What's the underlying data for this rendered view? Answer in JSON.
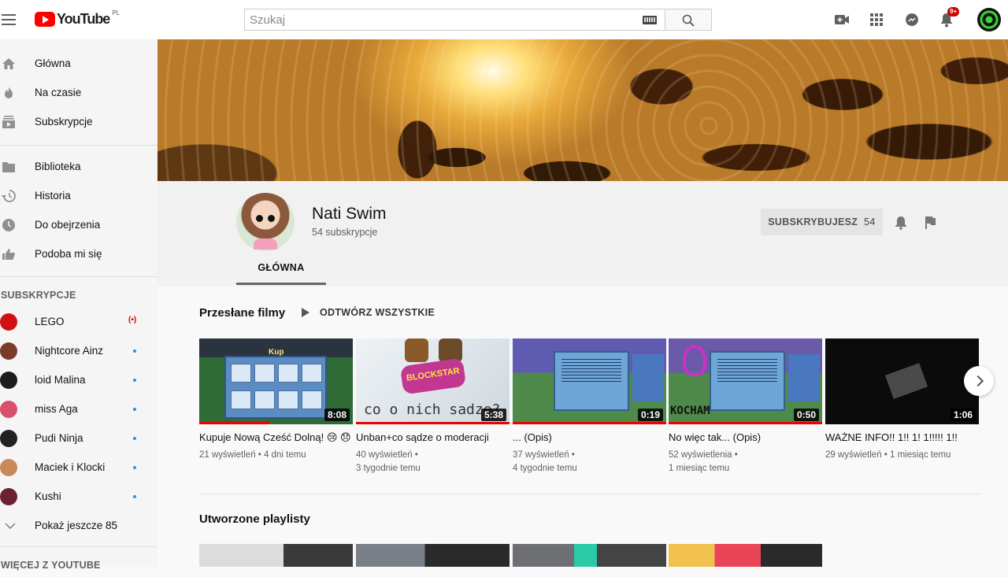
{
  "header": {
    "logo_text": "YouTube",
    "logo_country": "PL",
    "search_placeholder": "Szukaj",
    "notifications_badge": "9+"
  },
  "sidebar": {
    "main_items": [
      {
        "label": "Główna",
        "icon": "home-icon"
      },
      {
        "label": "Na czasie",
        "icon": "flame-icon"
      },
      {
        "label": "Subskrypcje",
        "icon": "subscriptions-icon"
      }
    ],
    "library_items": [
      {
        "label": "Biblioteka",
        "icon": "folder-icon"
      },
      {
        "label": "Historia",
        "icon": "history-icon"
      },
      {
        "label": "Do obejrzenia",
        "icon": "clock-icon"
      },
      {
        "label": "Podoba mi się",
        "icon": "thumb-up-icon"
      }
    ],
    "subscriptions_heading": "SUBSKRYPCJE",
    "subscriptions": [
      {
        "label": "LEGO",
        "live": "(•)",
        "color": "#d01012"
      },
      {
        "label": "Nightcore Ainz",
        "color": "#7a3c2a"
      },
      {
        "label": "loid Malina",
        "color": "#1c1c1c"
      },
      {
        "label": "miss Aga",
        "color": "#d9506a"
      },
      {
        "label": "Pudi Ninja",
        "color": "#222222"
      },
      {
        "label": "Maciek i Klocki",
        "color": "#c98a5a"
      },
      {
        "label": "Kushi",
        "color": "#6a2230"
      }
    ],
    "show_more": "Pokaż jeszcze 85",
    "more_heading": "WIĘCEJ Z YOUTUBE"
  },
  "channel": {
    "name": "Nati Swim",
    "subscribers": "54 subskrypcje",
    "subscribe_label": "SUBSKRYBUJESZ",
    "subscribe_count": "54",
    "tab_home": "GŁÓWNA"
  },
  "uploads": {
    "title": "Przesłane filmy",
    "play_all": "ODTWÓRZ WSZYSTKIE",
    "videos": [
      {
        "title": "Kupuje Nową Cześć Dolną! 😢 😞",
        "duration": "8:08",
        "meta1": "21 wyświetleń • 4 dni temu",
        "meta2": "",
        "progress": 0.46
      },
      {
        "title": "Unban+co sądze o moderacji",
        "duration": "5:38",
        "meta1": "40 wyświetleń •",
        "meta2": "3 tygodnie temu",
        "progress": 1.0
      },
      {
        "title": "... (Opis)",
        "duration": "0:19",
        "meta1": "37 wyświetleń •",
        "meta2": "4 tygodnie temu",
        "progress": 1.0
      },
      {
        "title": "No więc tak... (Opis)",
        "duration": "0:50",
        "meta1": "52 wyświetlenia •",
        "meta2": "1 miesiąc temu",
        "progress": 1.0
      },
      {
        "title": "WAŻNE INFO!! 1!! 1! 1!!!!! 1!!",
        "duration": "1:06",
        "meta1": "29 wyświetleń • 1 miesiąc temu",
        "meta2": "",
        "progress": 0
      }
    ]
  },
  "playlists": {
    "title": "Utworzone playlisty"
  },
  "thumb_texts": {
    "shop": "Kup",
    "scribble2": "co o nich sadze?",
    "scribble4": "KOCHAM"
  }
}
